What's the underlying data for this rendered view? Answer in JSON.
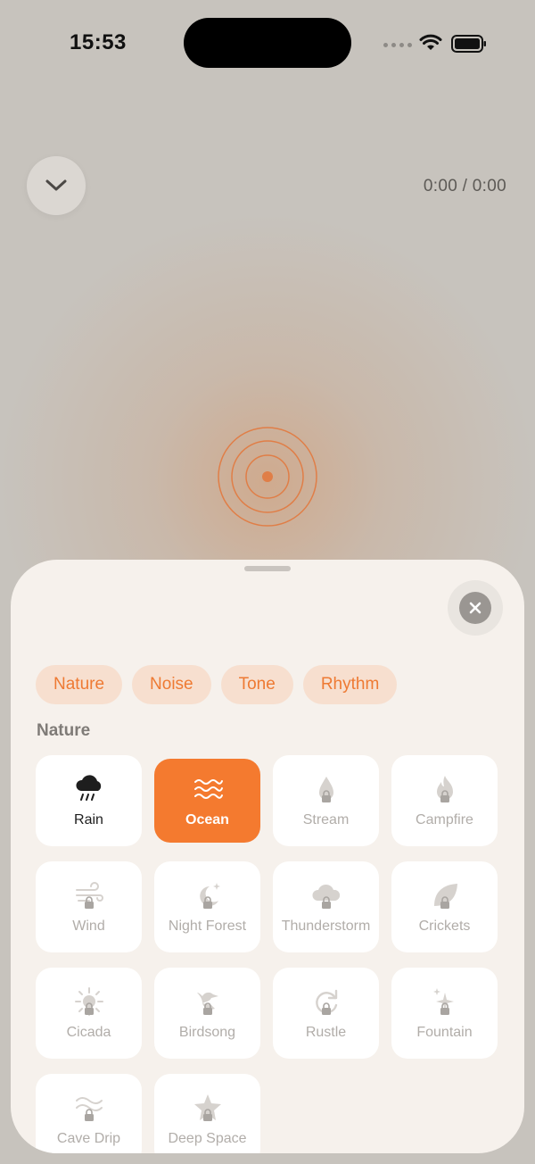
{
  "status_bar": {
    "time": "15:53"
  },
  "player": {
    "time_readout": "0:00 / 0:00"
  },
  "sheet": {
    "tabs": [
      {
        "label": "Nature"
      },
      {
        "label": "Noise"
      },
      {
        "label": "Tone"
      },
      {
        "label": "Rhythm"
      }
    ],
    "section_title": "Nature",
    "sounds": [
      {
        "label": "Rain",
        "icon": "rain-cloud-icon",
        "state": "unlocked"
      },
      {
        "label": "Ocean",
        "icon": "waves-icon",
        "state": "selected"
      },
      {
        "label": "Stream",
        "icon": "droplet-icon",
        "state": "locked"
      },
      {
        "label": "Campfire",
        "icon": "flame-icon",
        "state": "locked"
      },
      {
        "label": "Wind",
        "icon": "wind-icon",
        "state": "locked"
      },
      {
        "label": "Night Forest",
        "icon": "moon-stars-icon",
        "state": "locked"
      },
      {
        "label": "Thunderstorm",
        "icon": "cloud-icon",
        "state": "locked"
      },
      {
        "label": "Crickets",
        "icon": "leaf-icon",
        "state": "locked"
      },
      {
        "label": "Cicada",
        "icon": "sun-icon",
        "state": "locked"
      },
      {
        "label": "Birdsong",
        "icon": "bird-icon",
        "state": "locked"
      },
      {
        "label": "Rustle",
        "icon": "refresh-icon",
        "state": "locked"
      },
      {
        "label": "Fountain",
        "icon": "sparkle-icon",
        "state": "locked"
      },
      {
        "label": "Cave Drip",
        "icon": "cave-waves-icon",
        "state": "locked"
      },
      {
        "label": "Deep Space",
        "icon": "star-icon",
        "state": "locked"
      }
    ]
  },
  "colors": {
    "accent": "#f47a2f",
    "tab_bg": "#f7dfcf",
    "sheet_bg": "#f6f1ec",
    "background": "#c7c3bd"
  }
}
